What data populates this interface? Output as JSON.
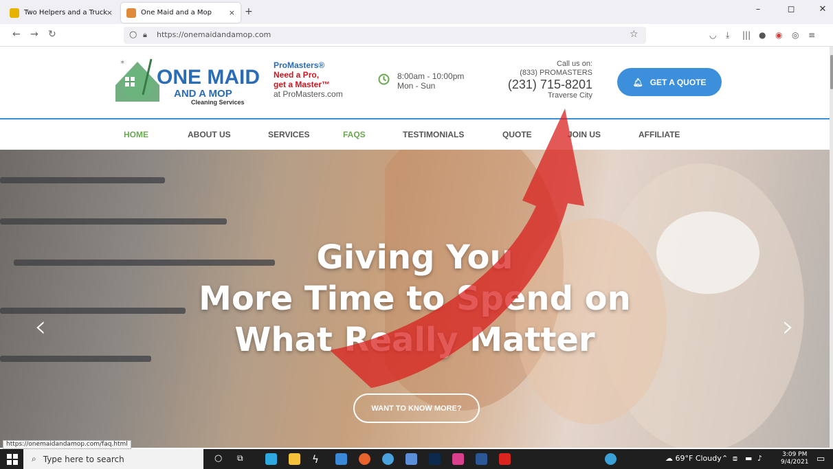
{
  "browser": {
    "tabs": [
      {
        "title": "Two Helpers and a Truck",
        "close": "×"
      },
      {
        "title": "One Maid and a Mop",
        "close": "×"
      }
    ],
    "new_tab": "+",
    "window_controls": [
      "–",
      "◻",
      "✕"
    ],
    "url": "https://onemaidandamop.com",
    "status_url": "https://onemaidandamop.com/faq.html"
  },
  "header": {
    "logo": {
      "line1": "ONE MAID",
      "line2": "AND A MOP",
      "line3": "Cleaning Services"
    },
    "promo": {
      "l1": "ProMasters®",
      "l2": "Need a Pro,",
      "l3": "get a Master™",
      "l4": "at ProMasters.com"
    },
    "hours": {
      "time": "8:00am - 10:00pm",
      "days": "Mon - Sun"
    },
    "call": {
      "label": "Call us on:",
      "vanity": "(833) PROMASTERS",
      "phone": "(231) 715-8201",
      "city": "Traverse City"
    },
    "quote_button": "GET A QUOTE"
  },
  "nav": [
    {
      "label": "HOME"
    },
    {
      "label": "ABOUT US"
    },
    {
      "label": "SERVICES"
    },
    {
      "label": "FAQS"
    },
    {
      "label": "TESTIMONIALS"
    },
    {
      "label": "QUOTE"
    },
    {
      "label": "JOIN US"
    },
    {
      "label": "AFFILIATE"
    }
  ],
  "hero": {
    "line1": "Giving You",
    "line2": "More Time to Spend on",
    "line3": "What Really Matter",
    "button": "WANT TO KNOW MORE?",
    "prev": "‹",
    "next": "›"
  },
  "taskbar": {
    "search_placeholder": "Type here to search",
    "weather": "69°F  Cloudy",
    "time": "3:09 PM",
    "date": "9/4/2021"
  },
  "colors": {
    "brand_blue": "#2a6cb5",
    "accent_blue": "#3c8fdb",
    "promo_red": "#d2141e",
    "nav_active_green": "#6aa84f"
  }
}
